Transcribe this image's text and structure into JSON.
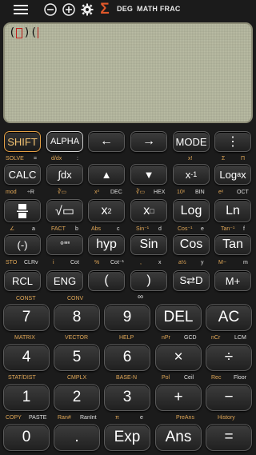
{
  "topbar": {
    "deg": "DEG",
    "mode": "MATH FRAC"
  },
  "display": {
    "expression_open": "(",
    "expression_mid": ")("
  },
  "keys": {
    "shift": "SHIFT",
    "alpha": "ALPHA",
    "left": "←",
    "right": "→",
    "mode": "MODE",
    "more": "⋮",
    "calc": "CALC",
    "integral": "∫dx",
    "up": "▲",
    "down": "▼",
    "inverse": "x",
    "inverse_sup": "-1",
    "log_a": "Log",
    "log_a_sub": "a",
    "log_a_x": "x",
    "fraction": "▭",
    "sqrt": "√▭",
    "square": "x",
    "square_sup": "2",
    "power": "x",
    "power_sup": "□",
    "log": "Log",
    "ln": "Ln",
    "neg": "(-)",
    "deg_min_sec": "°'\"",
    "hyp": "hyp",
    "sin": "Sin",
    "cos": "Cos",
    "tan": "Tan",
    "rcl": "RCL",
    "eng": "ENG",
    "lparen": "(",
    "rparen": ")",
    "s_d": "S⇄D",
    "m_plus": "M+",
    "n7": "7",
    "n8": "8",
    "n9": "9",
    "del": "DEL",
    "ac": "AC",
    "n4": "4",
    "n5": "5",
    "n6": "6",
    "multiply": "×",
    "divide": "÷",
    "n1": "1",
    "n2": "2",
    "n3": "3",
    "plus": "+",
    "minus": "−",
    "n0": "0",
    "dot": ".",
    "exp": "Exp",
    "ans": "Ans",
    "equals": "="
  },
  "labels": {
    "r1": [
      "SOLVE",
      "=",
      "d/dx",
      ":",
      "x!",
      "Σ",
      "Π"
    ],
    "r2": [
      "mod",
      "÷R",
      "∛▭",
      "x³",
      "DEC",
      "∛▭",
      "HEX",
      "10ˣ",
      "BIN",
      "eˣ",
      "OCT"
    ],
    "r3": [
      "∠",
      "a",
      "FACT",
      "b",
      "Abs",
      "c",
      "Sin⁻¹",
      "d",
      "Cos⁻¹",
      "e",
      "Tan⁻¹",
      "f"
    ],
    "r4": [
      "STO",
      "CLRv",
      "i",
      "Cot",
      "%",
      "Cot⁻¹",
      ",",
      "x",
      "a½",
      "y",
      "M−",
      "m"
    ],
    "r5": [
      "CONST",
      "CONV",
      "∞"
    ],
    "r6": [
      "MATRIX",
      "VECTOR",
      "HELP",
      "nPr",
      "GCD",
      "nCr",
      "LCM"
    ],
    "r7": [
      "STAT/DIST",
      "CMPLX",
      "BASE-N",
      "Pol",
      "Ceil",
      "Rec",
      "Floor"
    ],
    "r8": [
      "COPY",
      "PASTE",
      "Ran#",
      "RanInt",
      "π",
      "e",
      "PreAns",
      "History"
    ]
  }
}
